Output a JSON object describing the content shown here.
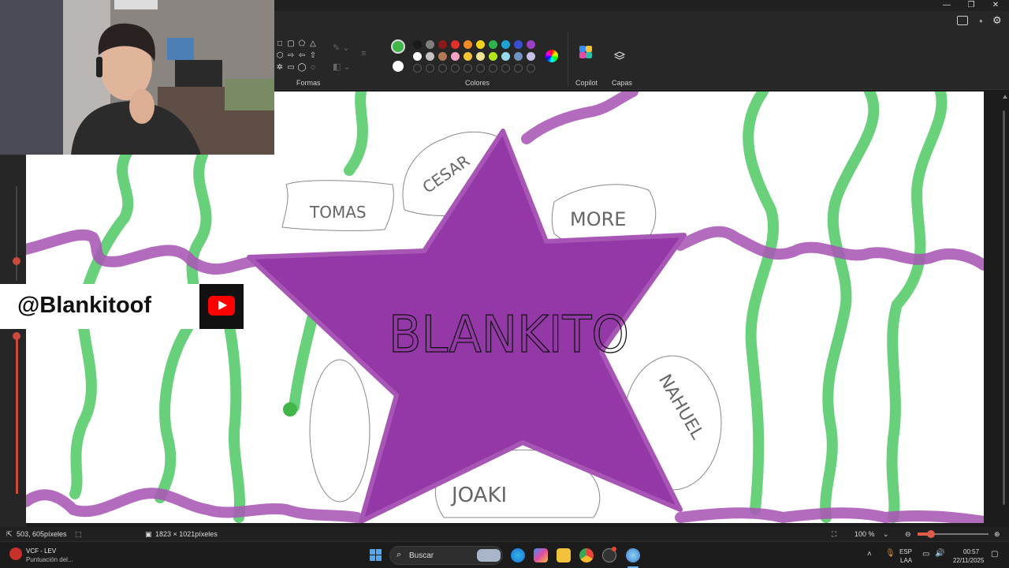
{
  "ribbon": {
    "shapes_label": "Formas",
    "colors_label": "Colores",
    "copilot_label": "Copilot",
    "layers_label": "Capas",
    "selected_color": "#3fb54a",
    "secondary_color": "#ffffff",
    "palette_row1": [
      "#1a1a1a",
      "#7f7f7f",
      "#8b1a1a",
      "#e0302a",
      "#f08a24",
      "#f3d21a",
      "#2fb24d",
      "#1fa2d4",
      "#3a4fd0",
      "#9b3fc3"
    ],
    "palette_row2": [
      "#ffffff",
      "#c3c3c3",
      "#b07a56",
      "#f6a3c4",
      "#f5c436",
      "#efe594",
      "#b5e61d",
      "#99d9ea",
      "#7092be",
      "#c8bfe7"
    ]
  },
  "canvas_text": {
    "center_word": "BLANKITO",
    "bubble_1": "TOMAS",
    "bubble_2": "CESAR",
    "bubble_3": "MORE",
    "bubble_4": "NAHUEL",
    "bubble_5": "JOAKI"
  },
  "overlay": {
    "handle": "@Blankitoof"
  },
  "statusbar": {
    "cursor_pos": "503, 605píxeles",
    "canvas_size": "1823 × 1021píxeles",
    "zoom": "100 %"
  },
  "taskbar": {
    "notification_title": "VCF - LEV",
    "notification_sub": "Puntuación del...",
    "search_placeholder": "Buscar",
    "lang_top": "ESP",
    "lang_bottom": "LAA",
    "time": "00:57",
    "date": "22/11/2025"
  },
  "colors": {
    "star_purple": "#9437a7",
    "line_purple": "#a856b5",
    "line_green": "#5ccd6f",
    "youtube_red": "#ff0000"
  }
}
